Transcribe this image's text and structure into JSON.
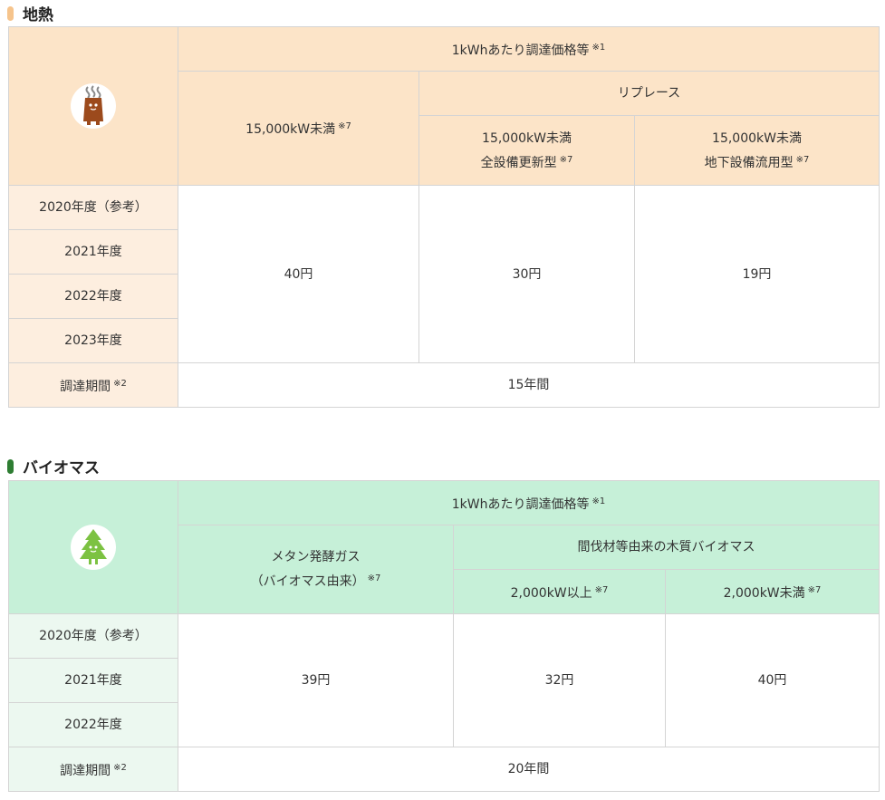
{
  "geothermal": {
    "title": "地熱",
    "accent_color": "#f6c48c",
    "icon": "geothermal-mascot-icon",
    "header_price": "1kWhあたり調達価格等",
    "header_price_note": "※1",
    "col1_label": "15,000kW未満",
    "col1_note": "※7",
    "replace_label": "リプレース",
    "col2_label_line1": "15,000kW未満",
    "col2_label_line2": "全設備更新型",
    "col2_note": "※7",
    "col3_label_line1": "15,000kW未満",
    "col3_label_line2": "地下設備流用型",
    "col3_note": "※7",
    "years": [
      "2020年度（参考）",
      "2021年度",
      "2022年度",
      "2023年度"
    ],
    "values": [
      "40円",
      "30円",
      "19円"
    ],
    "period_label": "調達期間",
    "period_note": "※2",
    "period_value": "15年間"
  },
  "biomass": {
    "title": "バイオマス",
    "accent_color": "#2e7d32",
    "icon": "tree-mascot-icon",
    "header_price": "1kWhあたり調達価格等",
    "header_price_note": "※1",
    "col1_label_line1": "メタン発酵ガス",
    "col1_label_line2": "（バイオマス由来）",
    "col1_note": "※7",
    "wood_label": "間伐材等由来の木質バイオマス",
    "col2_label": "2,000kW以上",
    "col2_note": "※7",
    "col3_label": "2,000kW未満",
    "col3_note": "※7",
    "years": [
      "2020年度（参考）",
      "2021年度",
      "2022年度"
    ],
    "values": [
      "39円",
      "32円",
      "40円"
    ],
    "period_label": "調達期間",
    "period_note": "※2",
    "period_value": "20年間"
  }
}
